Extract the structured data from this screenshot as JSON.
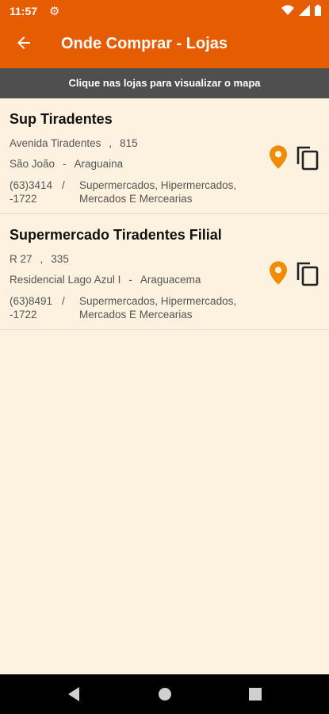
{
  "status": {
    "time": "11:57"
  },
  "appbar": {
    "title": "Onde Comprar - Lojas"
  },
  "hint": "Clique nas lojas para visualizar o mapa",
  "stores": [
    {
      "name": "Sup Tiradentes",
      "street": "Avenida Tiradentes",
      "number": "815",
      "district": "São João",
      "city": "Araguaina",
      "phone1": "(63)3414",
      "phone2": "-1722",
      "category1": "Supermercados, Hipermercados,",
      "category2": "Mercados E Mercearias"
    },
    {
      "name": "Supermercado Tiradentes Filial",
      "street": "R 27",
      "number": "335",
      "district": "Residencial Lago Azul I",
      "city": "Araguacema",
      "phone1": "(63)8491",
      "phone2": "-1722",
      "category1": "Supermercados, Hipermercados,",
      "category2": "Mercados E Mercearias"
    }
  ],
  "separators": {
    "comma": ",",
    "dash": "-",
    "slash": "/"
  },
  "colors": {
    "primary": "#e65c00",
    "accent": "#f08c00",
    "background": "#fdf1df",
    "hint_bar": "#4f4f4f"
  },
  "icons": [
    "settings-icon",
    "wifi-icon",
    "signal-icon",
    "battery-icon",
    "back-arrow-icon",
    "map-pin-icon",
    "copy-icon",
    "nav-back-icon",
    "nav-home-icon",
    "nav-recents-icon"
  ]
}
